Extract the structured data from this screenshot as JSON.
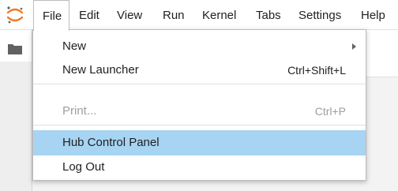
{
  "menubar": {
    "items": [
      {
        "label": "File"
      },
      {
        "label": "Edit"
      },
      {
        "label": "View"
      },
      {
        "label": "Run"
      },
      {
        "label": "Kernel"
      },
      {
        "label": "Tabs"
      },
      {
        "label": "Settings"
      },
      {
        "label": "Help"
      }
    ],
    "active": "File"
  },
  "file_menu": {
    "new": {
      "label": "New"
    },
    "new_launcher": {
      "label": "New Launcher",
      "shortcut": "Ctrl+Shift+L"
    },
    "print": {
      "label": "Print...",
      "shortcut": "Ctrl+P",
      "disabled": true
    },
    "hub_control_panel": {
      "label": "Hub Control Panel",
      "highlighted": true
    },
    "log_out": {
      "label": "Log Out"
    }
  },
  "icons": {
    "logo": "jupyter-logo-icon",
    "sidebar": "folder-icon",
    "submenu": "chevron-right-icon"
  },
  "colors": {
    "logo_orange": "#F37726",
    "highlight": "#A6D4F2",
    "disabled_text": "#9E9E9E",
    "text": "#212121"
  }
}
